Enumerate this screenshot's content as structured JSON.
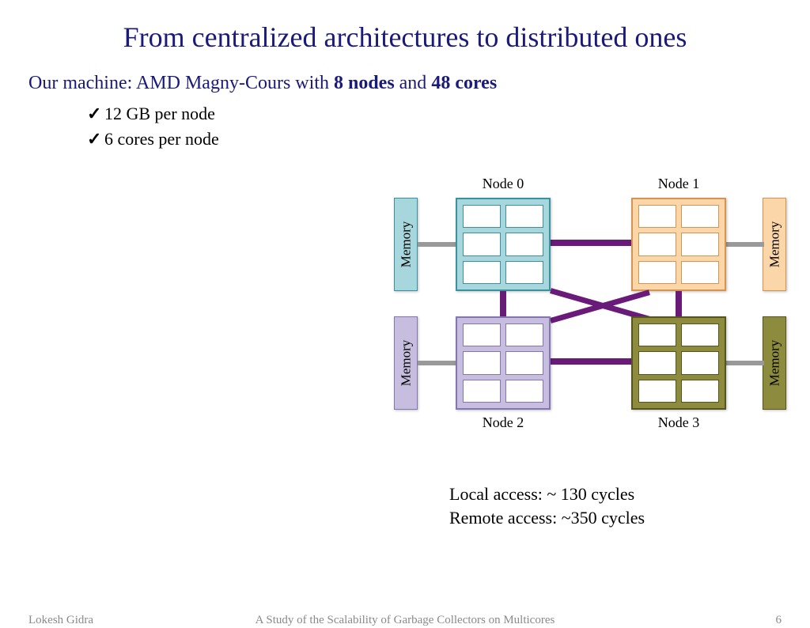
{
  "title": "From centralized architectures to distributed ones",
  "subtitle_prefix": "Our machine: AMD Magny-Cours with ",
  "subtitle_nodes": "8 nodes",
  "subtitle_and": " and ",
  "subtitle_cores": "48 cores",
  "bullets": {
    "b1": "12 GB per node",
    "b2": "6 cores per node"
  },
  "diagram": {
    "memory_label": "Memory",
    "node0": "Node 0",
    "node1": "Node 1",
    "node2": "Node 2",
    "node3": "Node 3",
    "colors": {
      "n0_fill": "#a8d6dd",
      "n0_border": "#3a929e",
      "n1_fill": "#fbd6a9",
      "n1_border": "#d59450",
      "n2_fill": "#c6bddf",
      "n2_border": "#8676b0",
      "n3_fill": "#8c8b3e",
      "n3_border": "#56551e"
    }
  },
  "access": {
    "local": "Local access: ~ 130 cycles",
    "remote": "Remote access: ~350 cycles"
  },
  "footer": {
    "author": "Lokesh Gidra",
    "study": "A Study of the Scalability of Garbage Collectors on Multicores",
    "page": "6"
  }
}
